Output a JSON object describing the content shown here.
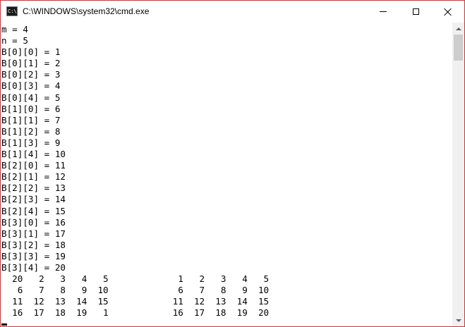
{
  "window": {
    "title": "C:\\WINDOWS\\system32\\cmd.exe",
    "icon_label": "C:\\.",
    "colors": {
      "border": "#c23a3a",
      "background": "#ffffff",
      "text": "#000000"
    }
  },
  "controls": {
    "minimize": "minimize-icon",
    "maximize": "maximize-icon",
    "close": "close-icon"
  },
  "console": {
    "lines": [
      "m = 4",
      "n = 5",
      "B[0][0] = 1",
      "B[0][1] = 2",
      "B[0][2] = 3",
      "B[0][3] = 4",
      "B[0][4] = 5",
      "B[1][0] = 6",
      "B[1][1] = 7",
      "B[1][2] = 8",
      "B[1][3] = 9",
      "B[1][4] = 10",
      "B[2][0] = 11",
      "B[2][1] = 12",
      "B[2][2] = 13",
      "B[2][3] = 14",
      "B[2][4] = 15",
      "B[3][0] = 16",
      "B[3][1] = 17",
      "B[3][2] = 18",
      "B[3][3] = 19",
      "B[3][4] = 20",
      "  20   2   3   4   5             1   2   3   4   5",
      "   6   7   8   9  10             6   7   8   9  10",
      "  11  12  13  14  15            11  12  13  14  15",
      "  16  17  18  19   1            16  17  18  19  20"
    ]
  }
}
